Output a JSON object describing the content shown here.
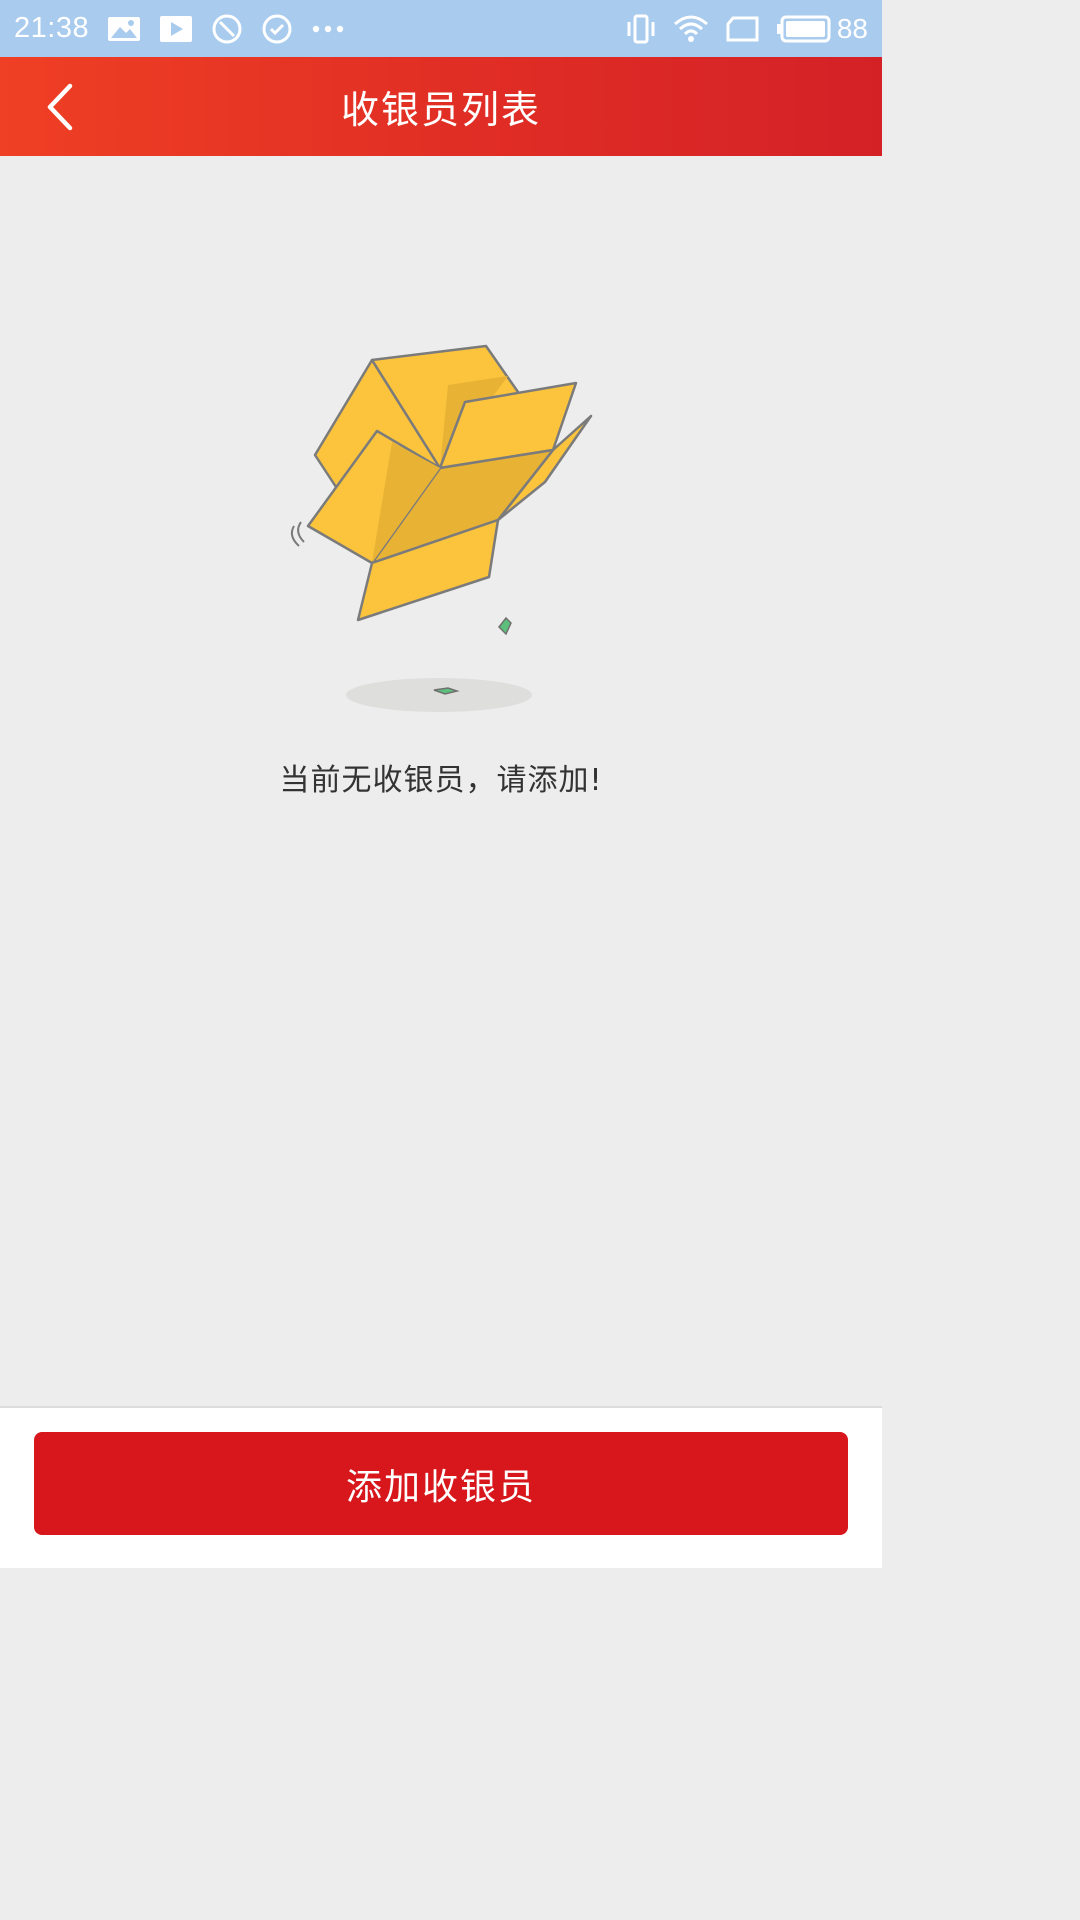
{
  "status_bar": {
    "time": "21:38",
    "battery_level": "88",
    "left_icons": [
      "gallery-icon",
      "play-icon",
      "block-icon",
      "check-circle-icon",
      "more-dots-icon"
    ],
    "right_icons": [
      "vibrate-icon",
      "wifi-icon",
      "sim-card-icon",
      "battery-icon"
    ]
  },
  "app_bar": {
    "title": "收银员列表",
    "back_icon": "chevron-left-icon",
    "colors": {
      "start": "#ef3f24",
      "end": "#d42126"
    }
  },
  "empty_state": {
    "illustration": "open-box-icon",
    "message": "当前无收银员，请添加!"
  },
  "footer": {
    "add_button_label": "添加收银员",
    "button_color": "#d7171c"
  }
}
